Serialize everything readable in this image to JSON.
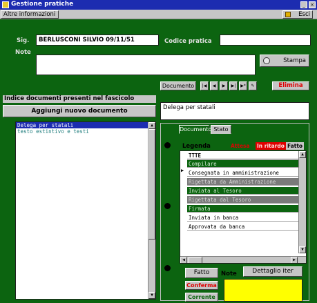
{
  "window": {
    "title": "Gestione pratiche",
    "controls": [
      "_",
      "×"
    ]
  },
  "menubar": {
    "altre_label": "Altre informazioni",
    "esci_label": "Esci"
  },
  "form": {
    "sig_label": "Sig.",
    "sig_value": "BERLUSCONI SILVIO 09/11/51",
    "codice_label": "Codice pratica",
    "codice_value": "",
    "note_label": "Note",
    "note_value": "",
    "stampa_label": "Stampa"
  },
  "left_panel": {
    "indice_label": "Indice documenti presenti nel fascicolo",
    "aggiungi_label": "Aggiungi nuovo documento",
    "documents": [
      "Delega per statali",
      "testo estintivo e testi"
    ],
    "selected_index": 0
  },
  "doc_toolbar": {
    "documento_label": "Documento",
    "nav_buttons": [
      "|◀",
      "◀",
      "▶",
      "▶|",
      "▶*",
      "✎"
    ],
    "elimina_label": "Elimina"
  },
  "doc_title_value": "Delega per statali",
  "tabs": [
    {
      "label": "Documento",
      "active": false
    },
    {
      "label": "Stato",
      "active": true
    }
  ],
  "legenda": {
    "label": "Legenda",
    "items": [
      {
        "label": "Attesa",
        "color": "#0c6410",
        "text_color": "#e00000"
      },
      {
        "label": "In ritardo",
        "color": "#e00000",
        "text_color": "#ffe0e0"
      },
      {
        "label": "Fatto",
        "color": "#c6c6c6",
        "text_color": "#000000"
      }
    ]
  },
  "stato_list": {
    "header": "TTTE",
    "rows": [
      {
        "label": "Compilare",
        "style": "green"
      },
      {
        "label": "Consegnata in amministrazione",
        "style": "white"
      },
      {
        "label": "Rigettata da Amministrazione",
        "style": "gray"
      },
      {
        "label": "Inviata al Tesoro",
        "style": "green"
      },
      {
        "label": "Rigettata dal Tesoro",
        "style": "gray"
      },
      {
        "label": "Firmata",
        "style": "green"
      },
      {
        "label": "Inviata in banca",
        "style": "white"
      },
      {
        "label": "Approvata da banca",
        "style": "white"
      }
    ],
    "marker": "▶"
  },
  "bottom": {
    "fatto_label": "Fatto",
    "note_label": "Note",
    "dettaglio_label": "Dettaglio iter",
    "conferma_label": "Conferma",
    "corrente_label": "Corrente",
    "note_value": ""
  },
  "colors": {
    "background": "#0c6410",
    "titlebar": "#1c2cb0",
    "note_field": "#ffff00",
    "alert": "#e00000"
  }
}
